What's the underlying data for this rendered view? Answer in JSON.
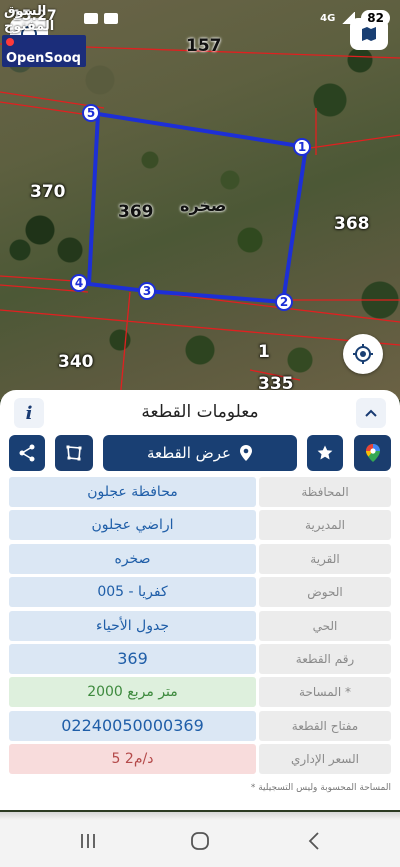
{
  "status_bar": {
    "time": "15:27",
    "network": "4G",
    "battery": "82"
  },
  "watermark": {
    "arabic": "السوق المفتوح",
    "english": "OpenSooq"
  },
  "map": {
    "parcel_labels": [
      {
        "id": "p157",
        "text": "157"
      },
      {
        "id": "p370",
        "text": "370"
      },
      {
        "id": "p369",
        "text": "369"
      },
      {
        "id": "p368",
        "text": "368"
      },
      {
        "id": "p340",
        "text": "340"
      },
      {
        "id": "p1",
        "text": "1"
      },
      {
        "id": "p335",
        "text": "335"
      }
    ],
    "village_label": "صخره",
    "vertices": [
      "1",
      "2",
      "3",
      "4",
      "5"
    ],
    "colors": {
      "parcel_outline": "#1d2fd6",
      "boundaries": "#e02020"
    }
  },
  "panel": {
    "title": "معلومات القطعة",
    "info_label": "i",
    "show_parcel_label": "عرض القطعة",
    "rows": [
      {
        "label": "المحافظة",
        "value": "محافظة عجلون"
      },
      {
        "label": "المديرية",
        "value": "اراضي عجلون"
      },
      {
        "label": "القرية",
        "value": "صخره"
      },
      {
        "label": "الحوض",
        "value": "كفريا - 005"
      },
      {
        "label": "الحي",
        "value": "جدول الأحياء"
      },
      {
        "label": "رقم القطعة",
        "value": "369"
      },
      {
        "label": "المساحة *",
        "value": "2000  متر مربع"
      },
      {
        "label": "مفتاح القطعة",
        "value": "02240050000369"
      },
      {
        "label": "السعر الإداري",
        "value": "5 د/م2"
      }
    ],
    "footnote": "* المساحة المحسوبة وليس التسجيلية",
    "colors": {
      "primary": "#193f73",
      "value_text": "#1f5ea8",
      "area_bg": "#def0dd",
      "price_bg": "#f8dcdc"
    }
  },
  "icons": {
    "share": "share-icon",
    "shape": "polygon-icon",
    "pin": "map-pin-icon",
    "star": "star-icon",
    "gmaps": "google-maps-icon",
    "locate": "crosshair-icon",
    "chevron": "chevron-up-icon"
  }
}
